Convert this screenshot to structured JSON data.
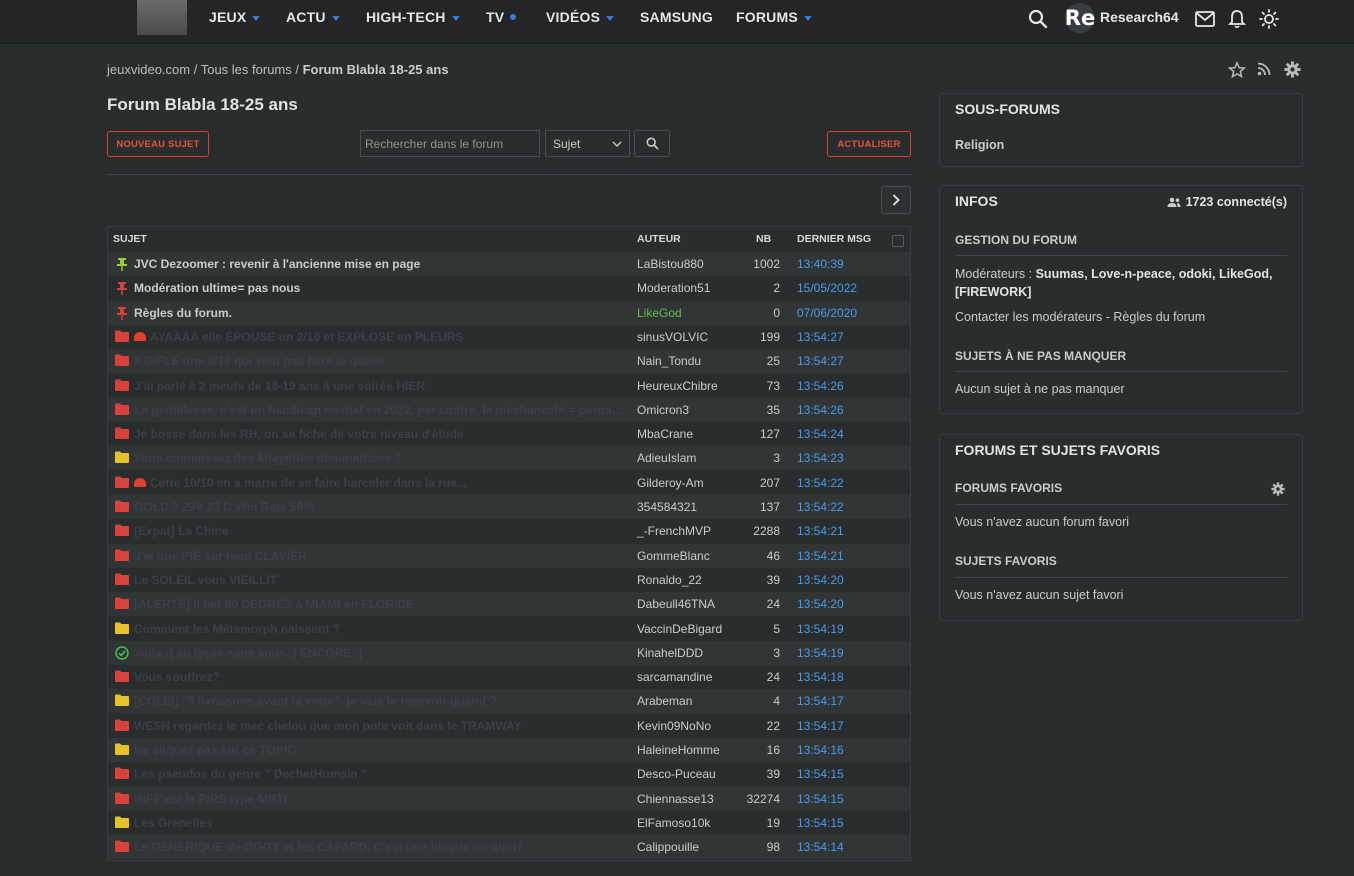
{
  "nav": {
    "items": [
      {
        "label": "JEUX",
        "marker": "caret"
      },
      {
        "label": "ACTU",
        "marker": "caret"
      },
      {
        "label": "HIGH-TECH",
        "marker": "caret"
      },
      {
        "label": "TV",
        "marker": "dot"
      },
      {
        "label": "VIDÉOS",
        "marker": "caret"
      },
      {
        "label": "SAMSUNG",
        "marker": "none"
      },
      {
        "label": "FORUMS",
        "marker": "caret"
      }
    ],
    "avatar_text": "Re",
    "username": "Research64",
    "icons": [
      "search-icon",
      "mail-icon",
      "bell-icon",
      "sun-icon"
    ]
  },
  "breadcrumb": {
    "site": "jeuxvideo.com",
    "sep": " / ",
    "all": "Tous les forums",
    "current": "Forum Blabla 18-25 ans"
  },
  "page_title": "Forum Blabla 18-25 ans",
  "toolbar": {
    "new_topic": "NOUVEAU SUJET",
    "search_placeholder": "Rechercher dans le forum",
    "search_scope": "Sujet",
    "refresh": "ACTUALISER"
  },
  "table": {
    "headers": {
      "subject": "SUJET",
      "author": "AUTEUR",
      "nb": "NB",
      "last": "DERNIER MSG"
    },
    "rows": [
      {
        "icon": "pin-green",
        "subject": "JVC Dezoomer : revenir à l'ancienne mise en page",
        "author": "LaBistou880",
        "nb": "1002",
        "last": "13:40:39",
        "pinned": true,
        "author_color": "#c9cbcc"
      },
      {
        "icon": "pin-red",
        "subject": "Modération ultime= pas nous",
        "author": "Moderation51",
        "nb": "2",
        "last": "15/05/2022",
        "pinned": true,
        "author_color": "#c9cbcc"
      },
      {
        "icon": "pin-red",
        "subject": "Règles du forum.",
        "author": "LikeGod",
        "nb": "0",
        "last": "07/06/2020",
        "pinned": true,
        "author_color": "#5fbf4d"
      },
      {
        "icon": "folder-red",
        "siren": true,
        "subject": "AYAAAA elle ÉPOUSE un 2/10 et EXPLOSE en PLEURS",
        "author": "sinusVOLVIC",
        "nb": "199",
        "last": "13:54:27"
      },
      {
        "icon": "folder-red",
        "subject": "Il GIFLE une 8/10 qui veut pas faire la queue",
        "author": "Nain_Tondu",
        "nb": "25",
        "last": "13:54:27"
      },
      {
        "icon": "folder-red",
        "subject": "J'ai parlé à 2 meufs de 18-19 ans à une soirée HIER",
        "author": "HeureuxChibre",
        "nb": "73",
        "last": "13:54:26"
      },
      {
        "icon": "folder-red",
        "subject": "La gentillesse, c'est un handicap mental en 2022, par contre, la méchanceté = permis de con...",
        "author": "Omicron3",
        "nb": "35",
        "last": "13:54:26"
      },
      {
        "icon": "folder-red",
        "subject": "Je bosse dans les RH, on se fiche de votre niveau d'étude",
        "author": "MbaCrane",
        "nb": "127",
        "last": "13:54:24"
      },
      {
        "icon": "folder-yellow",
        "subject": "Vous connaissez des khayettes dominatrices ?",
        "author": "AdieuIslam",
        "nb": "3",
        "last": "13:54:23"
      },
      {
        "icon": "folder-red",
        "siren": true,
        "subject": "Cette 10/10 en a marre de se faire harceler dans la rue...",
        "author": "Gilderoy-Am",
        "nb": "207",
        "last": "13:54:22"
      },
      {
        "icon": "folder-red",
        "subject": "GOLD 2 29V 23 D Win Rate 56%",
        "author": "354584321",
        "nb": "137",
        "last": "13:54:22"
      },
      {
        "icon": "folder-red",
        "subject": "[Expat] La Chine",
        "author": "_-FrenchMVP",
        "nb": "2288",
        "last": "13:54:21"
      },
      {
        "icon": "folder-red",
        "subject": "J'ai une PIE sur mon CLAVIER",
        "author": "GommeBlanc",
        "nb": "46",
        "last": "13:54:21"
      },
      {
        "icon": "folder-red",
        "subject": "Le SOLEIL vous VIEILLIT",
        "author": "Ronaldo_22",
        "nb": "39",
        "last": "13:54:20"
      },
      {
        "icon": "folder-red",
        "subject": "[ALERTE] Il fait 80 DEGRÉS à MIAMI en FLORIDE",
        "author": "Dabeull46TNA",
        "nb": "24",
        "last": "13:54:20"
      },
      {
        "icon": "folder-yellow",
        "subject": "Comment les Métamorph naissent ?",
        "author": "VaccinDeBigard",
        "nb": "5",
        "last": "13:54:19"
      },
      {
        "icon": "check-green",
        "subject": "Voila :) au lycée sans amis :) ENCORE :)",
        "author": "KinahelDDD",
        "nb": "3",
        "last": "13:54:19"
      },
      {
        "icon": "folder-red",
        "subject": "Vous souffrez?",
        "author": "sarcamandine",
        "nb": "24",
        "last": "13:54:18"
      },
      {
        "icon": "folder-yellow",
        "subject": "[COLIS] \"9 livraisons avant la votre\", je vais le recevoir quand ?",
        "author": "Arabeman",
        "nb": "4",
        "last": "13:54:17"
      },
      {
        "icon": "folder-red",
        "subject": "WESH regardez le mec chelou que mon pote voit dans le TRAMWAY",
        "author": "Kevin09NoNo",
        "nb": "22",
        "last": "13:54:17"
      },
      {
        "icon": "folder-yellow",
        "subject": "Ne cliquez pas sur ce TOPIC",
        "author": "HaleineHomme",
        "nb": "16",
        "last": "13:54:16"
      },
      {
        "icon": "folder-red",
        "subject": "Les pseudos du genre \" DechetHumain \"",
        "author": "Desco-Puceau",
        "nb": "39",
        "last": "13:54:15"
      },
      {
        "icon": "folder-red",
        "subject": "INFP est le PIRE type MBTI",
        "author": "Chiennasse13",
        "nb": "32274",
        "last": "13:54:15"
      },
      {
        "icon": "folder-yellow",
        "subject": "Les Grenelles",
        "author": "ElFamoso10k",
        "nb": "19",
        "last": "13:54:15"
      },
      {
        "icon": "folder-red",
        "subject": "Le GÉNÉRIQUE de OGGY et les CAFARD. C'est une blague ou quoi?",
        "author": "Calippouille",
        "nb": "98",
        "last": "13:54:14"
      }
    ]
  },
  "sidebar": {
    "subforums": {
      "title": "SOUS-FORUMS",
      "item": "Religion"
    },
    "infos": {
      "title": "INFOS",
      "connected": "1723 connecté(s)",
      "management": "GESTION DU FORUM",
      "moderators_label": "Modérateurs : ",
      "moderators": "Suumas, Love-n-peace, odoki, LikeGod, [FIREWORK]",
      "contact": "Contacter les modérateurs",
      "sep": " - ",
      "rules": "Règles du forum",
      "must_see_title": "SUJETS À NE PAS MANQUER",
      "must_see_empty": "Aucun sujet à ne pas manquer"
    },
    "favorites": {
      "title": "FORUMS ET SUJETS FAVORIS",
      "forums_title": "FORUMS FAVORIS",
      "forums_empty": "Vous n'avez aucun forum favori",
      "topics_title": "SUJETS FAVORIS",
      "topics_empty": "Vous n'avez aucun sujet favori"
    }
  },
  "colors": {
    "accent": "#3a7bd5",
    "danger": "#e3533c",
    "link_blue": "#4a9ae8",
    "folder_red": "#d9413b",
    "folder_yellow": "#e6c229",
    "pin_green": "#9acd32",
    "check_green": "#3cc85a"
  }
}
